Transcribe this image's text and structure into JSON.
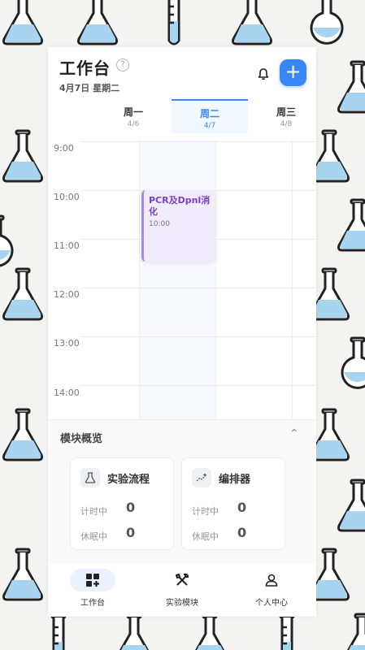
{
  "header": {
    "title": "工作台",
    "help_icon": "question-circle-icon",
    "date": "4月7日 星期二",
    "bell_icon": "bell-icon",
    "add_icon": "plus-icon"
  },
  "days": [
    {
      "name": "周一",
      "date": "4/6",
      "active": false
    },
    {
      "name": "周二",
      "date": "4/7",
      "active": true
    },
    {
      "name": "周三",
      "date": "4/8",
      "active": false
    }
  ],
  "times": [
    "9:00",
    "10:00",
    "11:00",
    "12:00",
    "13:00",
    "14:00"
  ],
  "event": {
    "title": "PCR及Dpnl消化",
    "time": "10:00",
    "day": "周二",
    "color": "#7a3fc7"
  },
  "modules": {
    "title": "模块概览",
    "collapse_icon": "chevron-up-icon",
    "cards": [
      {
        "name": "实验流程",
        "icon": "flask-icon",
        "timing_label": "计时中",
        "timing_value": "0",
        "sleep_label": "休眠中",
        "sleep_value": "0"
      },
      {
        "name": "编排器",
        "icon": "sparkle-icon",
        "timing_label": "计时中",
        "timing_value": "0",
        "sleep_label": "休眠中",
        "sleep_value": "0"
      }
    ]
  },
  "tabs": [
    {
      "label": "工作台",
      "icon": "dashboard-icon",
      "active": true
    },
    {
      "label": "实验模块",
      "icon": "tools-icon",
      "active": false
    },
    {
      "label": "个人中心",
      "icon": "user-icon",
      "active": false
    }
  ],
  "colors": {
    "accent": "#3a86f4",
    "event": "#7a3fc7",
    "flask_liquid": "#a8d4ef"
  }
}
